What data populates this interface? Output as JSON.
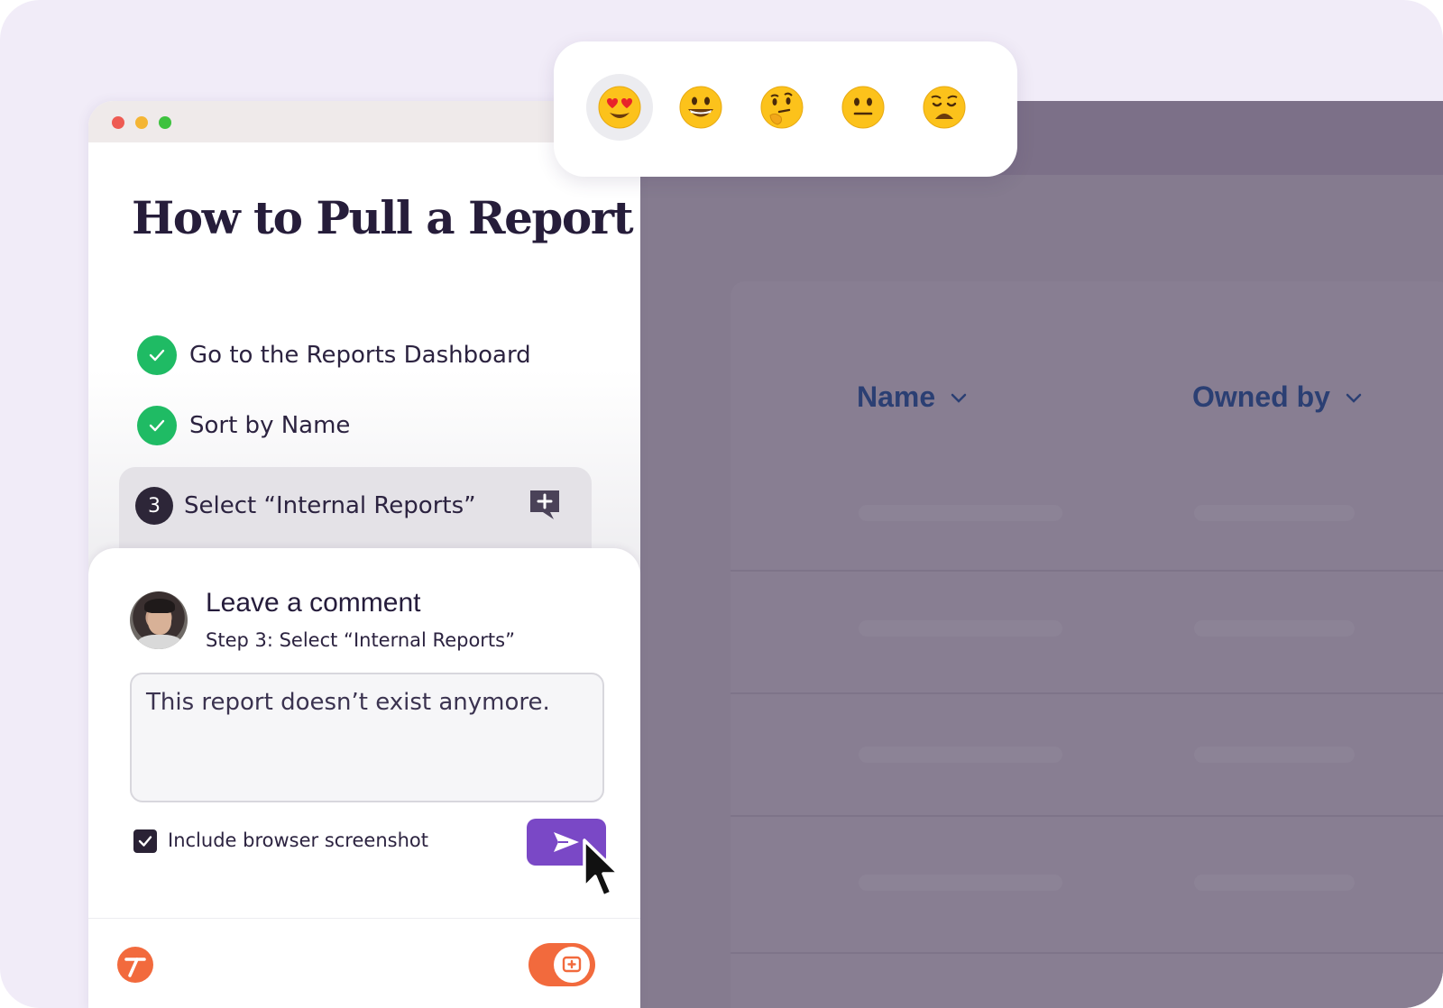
{
  "guide": {
    "title": "How to Pull a Report",
    "steps": [
      {
        "label": "Go to the Reports Dashboard",
        "status": "done"
      },
      {
        "label": "Sort by Name",
        "status": "done"
      },
      {
        "number": "3",
        "label": "Select “Internal Reports”",
        "status": "current"
      }
    ]
  },
  "comment": {
    "heading": "Leave a comment",
    "subheading": "Step 3: Select “Internal Reports”",
    "text": "This report doesn’t exist anymore.",
    "include_screenshot_label": "Include browser screenshot",
    "include_screenshot_checked": true
  },
  "reactions": {
    "icons": [
      "heart-eyes-emoji-icon",
      "grinning-emoji-icon",
      "thinking-emoji-icon",
      "neutral-emoji-icon",
      "weary-emoji-icon"
    ],
    "selected": "heart-eyes-emoji-icon"
  },
  "table": {
    "columns": [
      "Name",
      "Owned by"
    ]
  },
  "colors": {
    "accent_purple": "#7a48c6",
    "brand_orange": "#f26a3d",
    "success_green": "#1fbb64",
    "overlay": "#857b8f"
  }
}
